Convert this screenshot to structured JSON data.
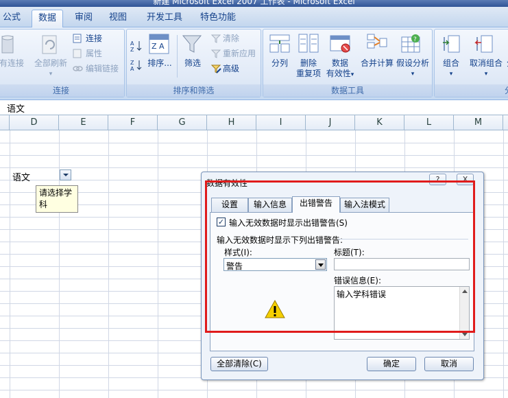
{
  "window": {
    "title": "新建 Microsoft Excel 2007 工作表 - Microsoft Excel"
  },
  "tabs": [
    "公式",
    "数据",
    "审阅",
    "视图",
    "开发工具",
    "特色功能"
  ],
  "active_tab": "数据",
  "ribbon": {
    "groups": {
      "connections": {
        "label": "连接",
        "existing_connections": "有连接",
        "refresh_all": "全部刷新",
        "connections": "连接",
        "properties": "属性",
        "edit_links": "编辑链接"
      },
      "sort_filter": {
        "label": "排序和筛选",
        "sort": "排序...",
        "filter": "筛选",
        "clear": "清除",
        "reapply": "重新应用",
        "advanced": "高级"
      },
      "data_tools": {
        "label": "数据工具",
        "text_to_columns": "分列",
        "remove_duplicates_1": "删除",
        "remove_duplicates_2": "重复项",
        "data_validation_1": "数据",
        "data_validation_2": "有效性",
        "consolidate": "合并计算",
        "what_if": "假设分析"
      },
      "outline": {
        "label": "分",
        "group": "组合",
        "ungroup": "取消组合",
        "subtotal": "分"
      }
    }
  },
  "formula_bar": {
    "content": "语文"
  },
  "columns": [
    "D",
    "E",
    "F",
    "G",
    "H",
    "I",
    "J",
    "K",
    "L",
    "M"
  ],
  "sheet": {
    "cell_value": "语文",
    "input_tip": "请选择学科"
  },
  "dialog": {
    "title": "数据有效性",
    "help_button": "?",
    "close_button": "X",
    "tabs": [
      "设置",
      "输入信息",
      "出错警告",
      "输入法模式"
    ],
    "active_tab": "出错警告",
    "show_error_checkbox": {
      "label": "输入无效数据时显示出错警告(S)",
      "checked": true
    },
    "section_label": "输入无效数据时显示下列出错警告:",
    "style": {
      "label": "样式(I):",
      "value": "警告"
    },
    "title_field": {
      "label": "标题(T):",
      "value": ""
    },
    "error_message": {
      "label": "错误信息(E):",
      "value": "输入学科错误"
    },
    "warning_icon": "warning-icon",
    "clear_all_button": "全部清除(C)",
    "ok_button": "确定",
    "cancel_button": "取消"
  },
  "highlight_color": "#e01b1b"
}
